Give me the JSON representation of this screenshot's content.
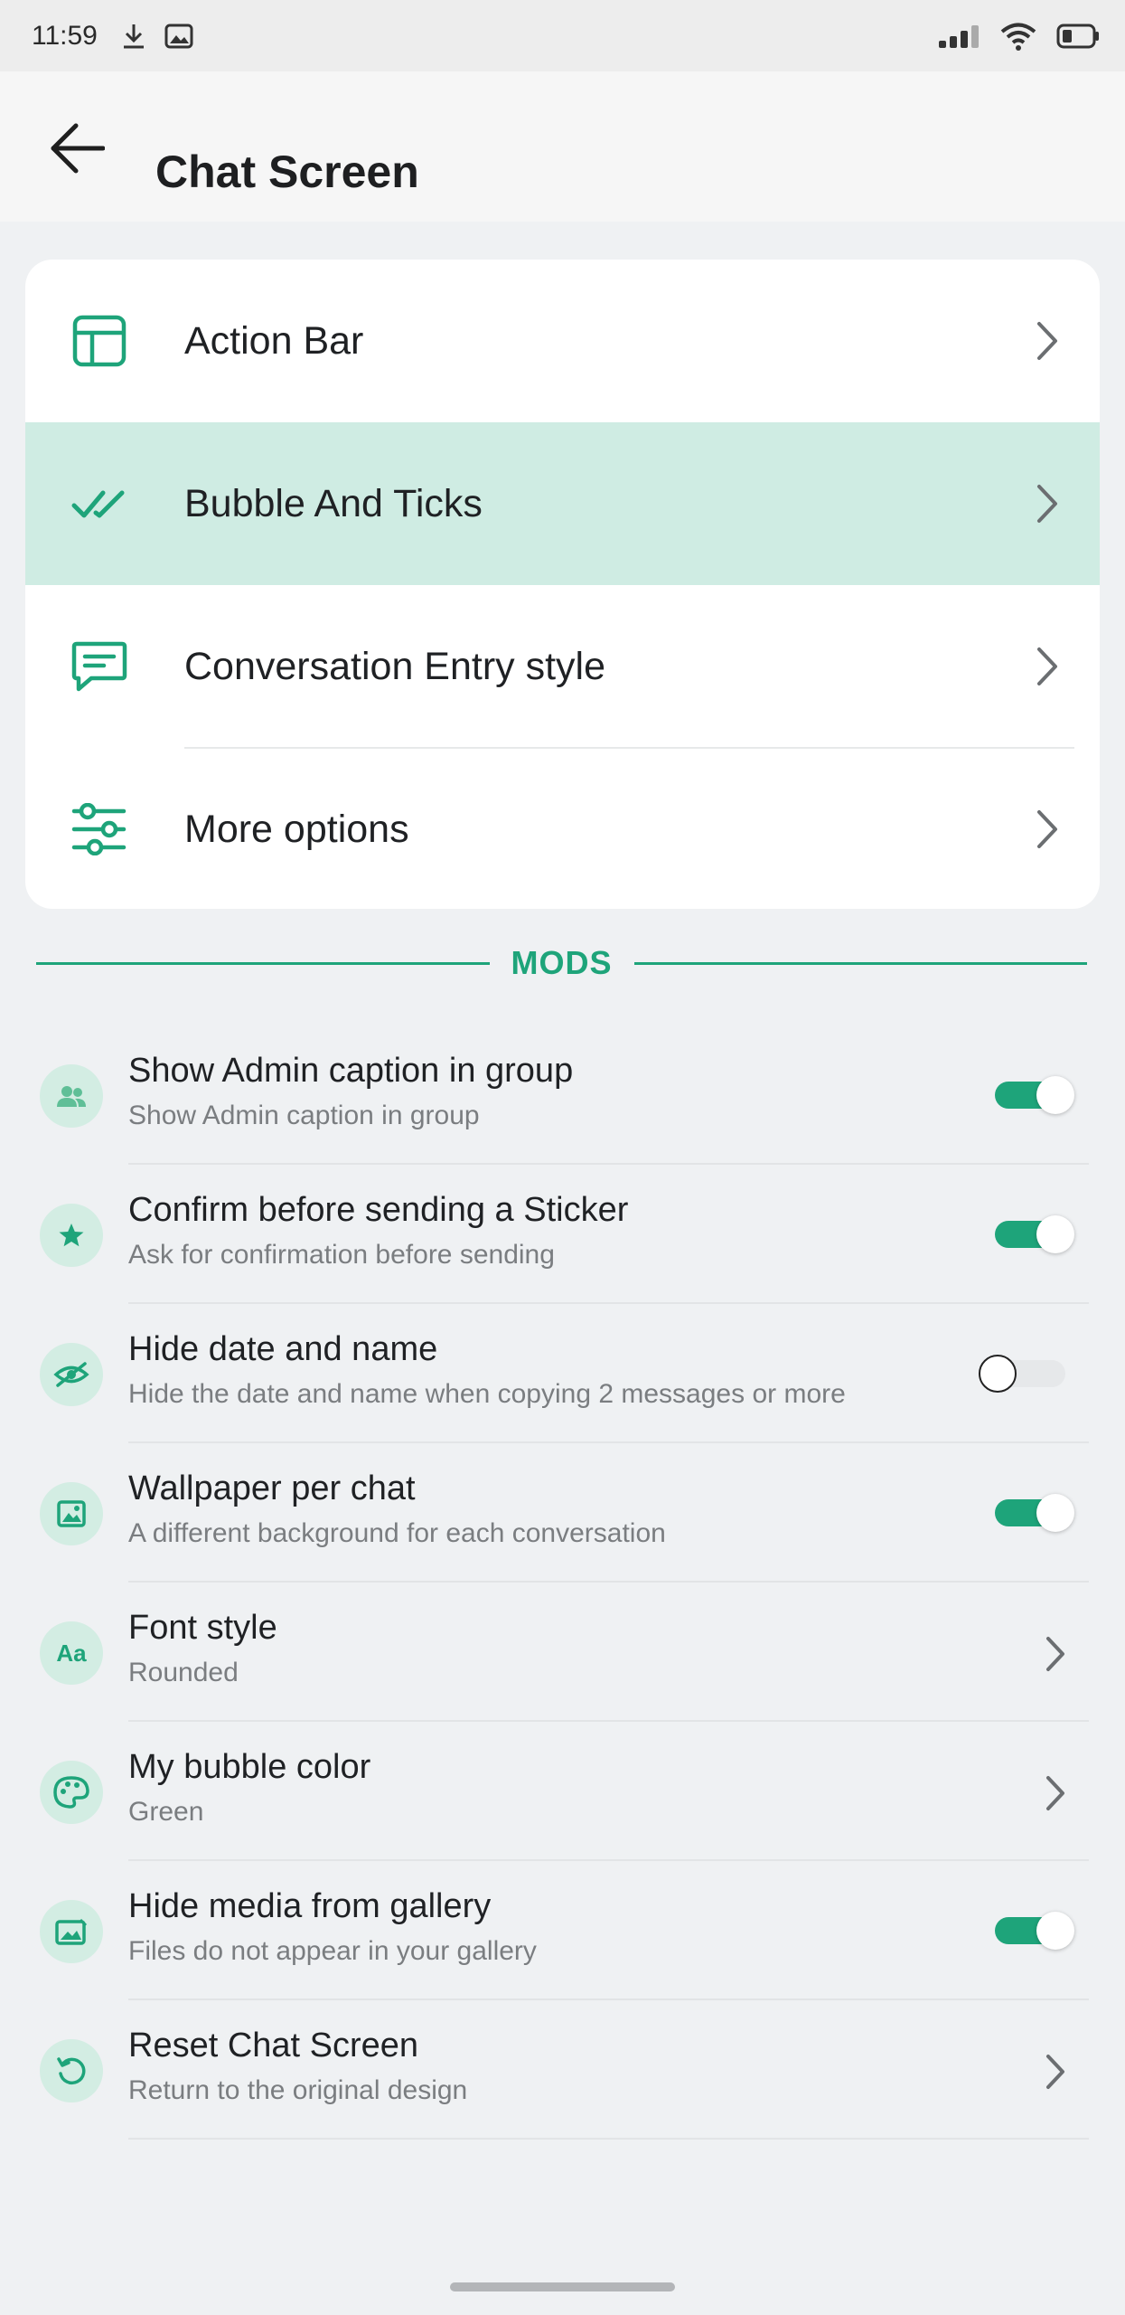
{
  "status_bar": {
    "time": "11:59",
    "left_icons": [
      "download-icon",
      "image-icon"
    ],
    "right_icons": [
      "signal-icon",
      "wifi-icon",
      "battery-icon"
    ]
  },
  "header": {
    "title": "Chat Screen",
    "back_icon": "arrow-left-icon"
  },
  "nav": {
    "items": [
      {
        "label": "Action Bar",
        "icon": "layout-icon",
        "active": false
      },
      {
        "label": "Bubble And Ticks",
        "icon": "double-check-icon",
        "active": true
      },
      {
        "label": "Conversation Entry style",
        "icon": "message-icon",
        "active": false
      },
      {
        "label": "More options",
        "icon": "sliders-icon",
        "active": false
      }
    ]
  },
  "section": {
    "title": "MODS"
  },
  "settings": [
    {
      "title": "Show Admin caption in group",
      "subtitle": "Show Admin caption in group",
      "icon": "users-icon",
      "control": "toggle",
      "on": true
    },
    {
      "title": "Confirm before sending a Sticker",
      "subtitle": "Ask for confirmation before sending",
      "icon": "star-icon",
      "control": "toggle",
      "on": true
    },
    {
      "title": "Hide date and name",
      "subtitle": "Hide the date and name when copying 2 messages or more",
      "icon": "eye-off-icon",
      "control": "toggle",
      "on": false
    },
    {
      "title": "Wallpaper per chat",
      "subtitle": "A different background for each conversation",
      "icon": "wallpaper-icon",
      "control": "toggle",
      "on": true
    },
    {
      "title": "Font style",
      "subtitle": "Rounded",
      "icon": "font-icon",
      "icon_text": "Aa",
      "control": "chevron"
    },
    {
      "title": "My bubble color",
      "subtitle": "Green",
      "icon": "palette-icon",
      "control": "chevron"
    },
    {
      "title": "Hide media from gallery",
      "subtitle": "Files do not appear in your gallery",
      "icon": "gallery-icon",
      "control": "toggle",
      "on": true
    },
    {
      "title": "Reset Chat Screen",
      "subtitle": "Return to the original design",
      "icon": "reset-icon",
      "control": "chevron"
    }
  ],
  "colors": {
    "accent": "#1ea47a",
    "active_row": "#cfece3",
    "icon_bg": "#d3ede3",
    "background": "#eff1f3"
  }
}
